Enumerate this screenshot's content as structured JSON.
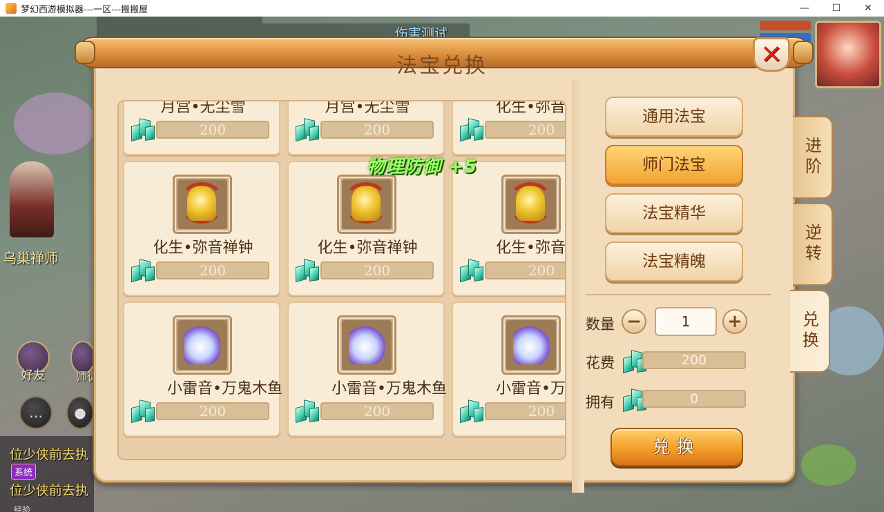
{
  "window": {
    "title": "梦幻西游模拟器---一区---搬搬屋",
    "minimize": "—",
    "maximize": "☐",
    "close": "✕"
  },
  "background": {
    "npc_name": "乌巢禅师",
    "top_banner": "伤害测试",
    "friends_label": "好友",
    "master_label": "师徒",
    "chat": [
      "位少侠前去执",
      "位少侠前去执"
    ],
    "chat_tag": "系统",
    "bottom_label": "经验"
  },
  "panel": {
    "title": "法宝兑换",
    "floating_text": "物理防御 +5"
  },
  "items": [
    {
      "name": "月宫•无尘雪",
      "price": "200",
      "icon": "snow-crystal-icon"
    },
    {
      "name": "月宫•无尘雪",
      "price": "200",
      "icon": "snow-crystal-icon"
    },
    {
      "name": "化生•弥音禅钟",
      "price": "200",
      "icon": "golden-bell-icon"
    },
    {
      "name": "化生•弥音禅钟",
      "price": "200",
      "icon": "golden-bell-icon"
    },
    {
      "name": "化生•弥音禅钟",
      "price": "200",
      "icon": "golden-bell-icon"
    },
    {
      "name": "化生•弥音禅钟",
      "price": "200",
      "icon": "golden-bell-icon"
    },
    {
      "name": "小雷音•万鬼木鱼",
      "price": "200",
      "icon": "spirit-orb-icon"
    },
    {
      "name": "小雷音•万鬼木鱼",
      "price": "200",
      "icon": "spirit-orb-icon"
    },
    {
      "name": "小雷音•万鬼木鱼",
      "price": "200",
      "icon": "spirit-orb-icon"
    }
  ],
  "categories": [
    {
      "label": "通用法宝",
      "active": false
    },
    {
      "label": "师门法宝",
      "active": true
    },
    {
      "label": "法宝精华",
      "active": false
    },
    {
      "label": "法宝精魄",
      "active": false
    }
  ],
  "side_tabs": [
    {
      "label": "进阶",
      "active": false
    },
    {
      "label": "逆转",
      "active": false
    },
    {
      "label": "兑换",
      "active": true
    }
  ],
  "exchange": {
    "quantity_label": "数量",
    "quantity_value": "1",
    "minus": "−",
    "plus": "+",
    "cost_label": "花费",
    "cost_value": "200",
    "owned_label": "拥有",
    "owned_value": "0",
    "button_label": "兑换"
  },
  "colors": {
    "accent": "#f3a32f",
    "panel_bg": "#f2dcbb",
    "close_red": "#d8211c",
    "floating_green": "#9dff6a"
  }
}
